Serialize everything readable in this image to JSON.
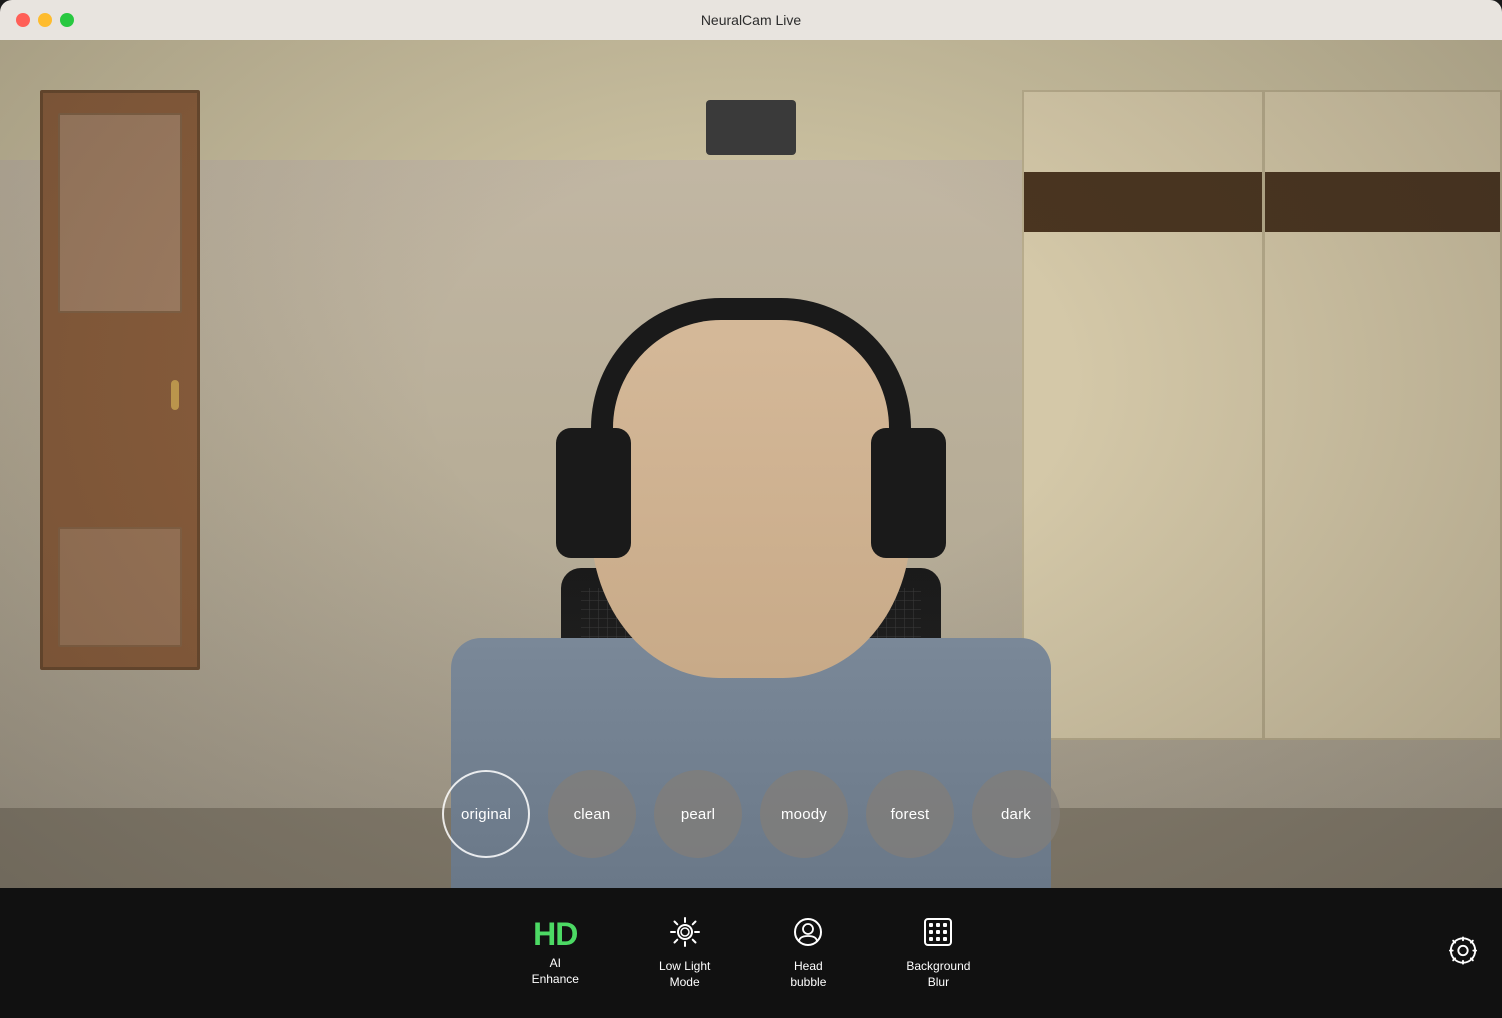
{
  "titlebar": {
    "title": "NeuralCam Live"
  },
  "windowControls": {
    "close": "close",
    "minimize": "minimize",
    "maximize": "maximize"
  },
  "filters": [
    {
      "id": "original",
      "label": "original",
      "selected": true
    },
    {
      "id": "clean",
      "label": "clean",
      "selected": false
    },
    {
      "id": "pearl",
      "label": "pearl",
      "selected": false
    },
    {
      "id": "moody",
      "label": "moody",
      "selected": false
    },
    {
      "id": "forest",
      "label": "forest",
      "selected": false
    },
    {
      "id": "dark",
      "label": "dark",
      "selected": false
    }
  ],
  "toolbar": {
    "items": [
      {
        "id": "ai-enhance",
        "iconType": "hd",
        "label": "AI\nEnhance",
        "label1": "AI",
        "label2": "Enhance"
      },
      {
        "id": "low-light",
        "iconType": "gear-sun",
        "label": "Low Light\nMode",
        "label1": "Low Light",
        "label2": "Mode"
      },
      {
        "id": "head-bubble",
        "iconType": "head-circle",
        "label": "Head\nbubble",
        "label1": "Head",
        "label2": "bubble"
      },
      {
        "id": "background-blur",
        "iconType": "blur-grid",
        "label": "Background\nBlur",
        "label1": "Background",
        "label2": "Blur"
      }
    ],
    "settingsIcon": "gear"
  },
  "colors": {
    "accent_green": "#4cd964",
    "toolbar_bg": "#111111",
    "filter_chip_bg": "rgba(130,125,120,0.75)",
    "filter_chip_selected_border": "rgba(255,255,255,0.85)"
  }
}
